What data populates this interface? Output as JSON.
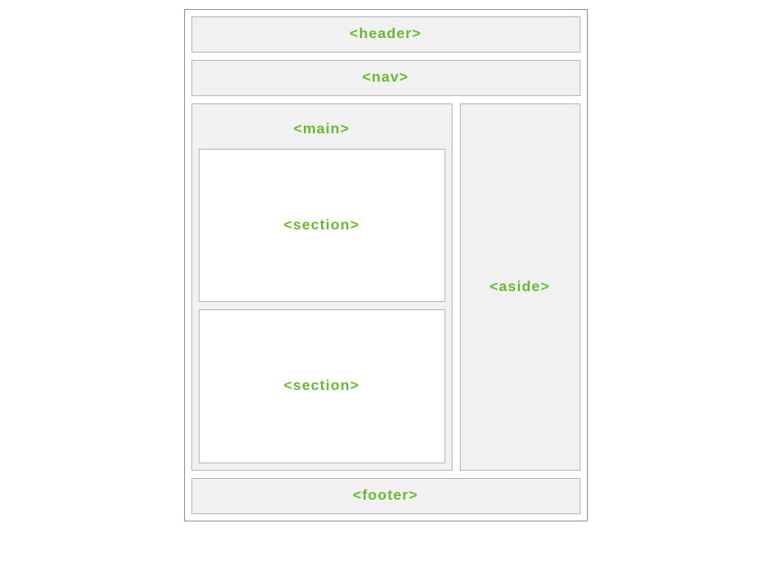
{
  "labels": {
    "header": "<header>",
    "nav": "<nav>",
    "main": "<main>",
    "section1": "<section>",
    "section2": "<section>",
    "aside": "<aside>",
    "footer": "<footer>"
  }
}
